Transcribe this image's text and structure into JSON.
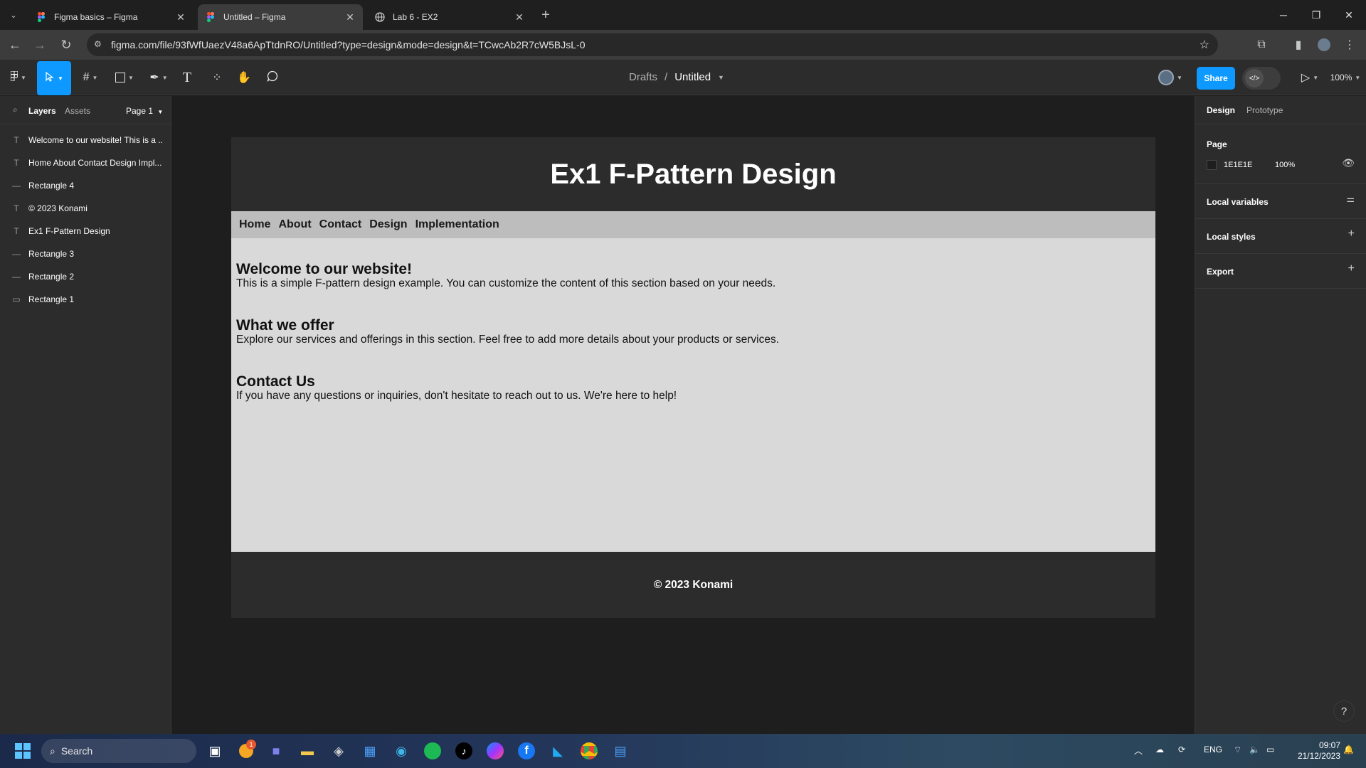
{
  "browser": {
    "tabs": [
      {
        "title": "Figma basics – Figma",
        "active": false
      },
      {
        "title": "Untitled – Figma",
        "active": true
      },
      {
        "title": "Lab 6 - EX2",
        "active": false
      }
    ],
    "new_tab_symbol": "+",
    "url": "figma.com/file/93fWfUaezV48a6ApTtdnRO/Untitled?type=design&mode=design&t=TCwcAb2R7cW5BJsL-0"
  },
  "toolbar": {
    "breadcrumb_parent": "Drafts",
    "breadcrumb_separator": "/",
    "file_name": "Untitled",
    "share_label": "Share",
    "zoom_label": "100%",
    "accent_color": "#0d99ff"
  },
  "left_panel": {
    "tabs": [
      "Layers",
      "Assets"
    ],
    "page_selector": "Page 1",
    "layers": [
      {
        "type": "text",
        "icon": "text-layer-icon",
        "name": "Welcome to our website! This is a ..."
      },
      {
        "type": "text",
        "icon": "text-layer-icon",
        "name": "Home About Contact Design Impl..."
      },
      {
        "type": "rect",
        "icon": "rectangle-line-icon",
        "name": "Rectangle 4"
      },
      {
        "type": "text",
        "icon": "text-layer-icon",
        "name": "© 2023 Konami"
      },
      {
        "type": "text",
        "icon": "text-layer-icon",
        "name": "Ex1 F-Pattern Design"
      },
      {
        "type": "rect",
        "icon": "rectangle-line-icon",
        "name": "Rectangle 3"
      },
      {
        "type": "rect",
        "icon": "rectangle-line-icon",
        "name": "Rectangle 2"
      },
      {
        "type": "rect",
        "icon": "rectangle-icon",
        "name": "Rectangle 1"
      }
    ]
  },
  "canvas": {
    "header_title": "Ex1 F-Pattern Design",
    "nav_items": [
      "Home",
      "About",
      "Contact",
      "Design",
      "Implementation"
    ],
    "sections": [
      {
        "heading": "Welcome to our website!",
        "body": "This is a simple F-pattern design example. You can customize the content of this section based on your needs."
      },
      {
        "heading": "What we offer",
        "body": "Explore our services and offerings in this section. Feel free to add more details about your products or services."
      },
      {
        "heading": "Contact Us",
        "body": "If you have any questions or inquiries, don't hesitate to reach out to us. We're here to help!"
      }
    ],
    "footer_text": "© 2023 Konami"
  },
  "right_panel": {
    "tabs": [
      "Design",
      "Prototype"
    ],
    "page_title": "Page",
    "page_color_hex": "1E1E1E",
    "page_color": "#1e1e1e",
    "page_opacity": "100%",
    "local_variables": "Local variables",
    "local_styles": "Local styles",
    "export": "Export",
    "help_symbol": "?"
  },
  "taskbar": {
    "search_placeholder": "Search",
    "language": "ENG",
    "time": "09:07",
    "date": "21/12/2023",
    "notification_count": "1"
  }
}
